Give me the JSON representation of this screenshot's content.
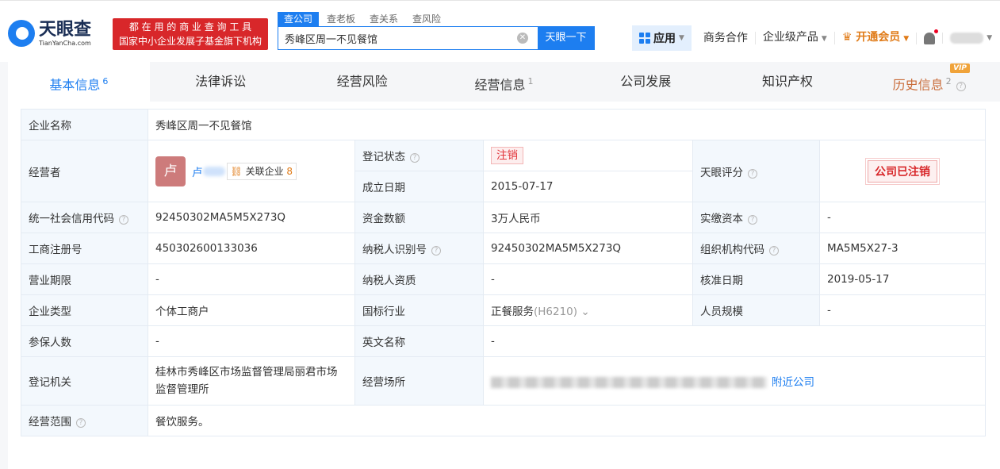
{
  "header": {
    "logo_cn": "天眼查",
    "logo_en": "TianYanCha.com",
    "slogan_line1": "都 在 用 的 商 业 查 询 工 具",
    "slogan_line2": "国家中小企业发展子基金旗下机构",
    "search_tabs": [
      "查公司",
      "查老板",
      "查关系",
      "查风险"
    ],
    "search_value": "秀峰区周一不见餐馆",
    "search_button": "天眼一下",
    "nav": {
      "apps": "应用",
      "business": "商务合作",
      "enterprise": "企业级产品",
      "vip": "开通会员"
    }
  },
  "tabs": [
    {
      "label": "基本信息",
      "count": "6"
    },
    {
      "label": "法律诉讼"
    },
    {
      "label": "经营风险"
    },
    {
      "label": "经营信息",
      "count": "1"
    },
    {
      "label": "公司发展"
    },
    {
      "label": "知识产权"
    },
    {
      "label": "历史信息",
      "count": "2",
      "badge": "VIP"
    }
  ],
  "info": {
    "company_name_label": "企业名称",
    "company_name": "秀峰区周一不见餐馆",
    "operator_label": "经营者",
    "operator_avatar": "卢",
    "operator_name": "卢",
    "related_label": "关联企业",
    "related_count": "8",
    "status_label": "登记状态",
    "status": "注销",
    "founded_label": "成立日期",
    "founded": "2015-07-17",
    "rating_label": "天眼评分",
    "rating_stamp": "公司已注销",
    "credit_code_label": "统一社会信用代码",
    "credit_code": "92450302MA5M5X273Q",
    "capital_label": "资金数额",
    "capital": "3万人民币",
    "paid_label": "实缴资本",
    "paid": "-",
    "reg_no_label": "工商注册号",
    "reg_no": "450302600133036",
    "tax_id_label": "纳税人识别号",
    "tax_id": "92450302MA5M5X273Q",
    "org_code_label": "组织机构代码",
    "org_code": "MA5M5X27-3",
    "term_label": "营业期限",
    "term": "-",
    "tax_qual_label": "纳税人资质",
    "tax_qual": "-",
    "approve_label": "核准日期",
    "approve": "2019-05-17",
    "type_label": "企业类型",
    "type": "个体工商户",
    "industry_label": "国标行业",
    "industry": "正餐服务",
    "industry_code": "(H6210)",
    "staff_label": "人员规模",
    "staff": "-",
    "insured_label": "参保人数",
    "insured": "-",
    "en_name_label": "英文名称",
    "en_name": "-",
    "authority_label": "登记机关",
    "authority": "桂林市秀峰区市场监督管理局丽君市场监督管理所",
    "address_label": "经营场所",
    "nearby": "附近公司",
    "scope_label": "经营范围",
    "scope": "餐饮服务。"
  }
}
